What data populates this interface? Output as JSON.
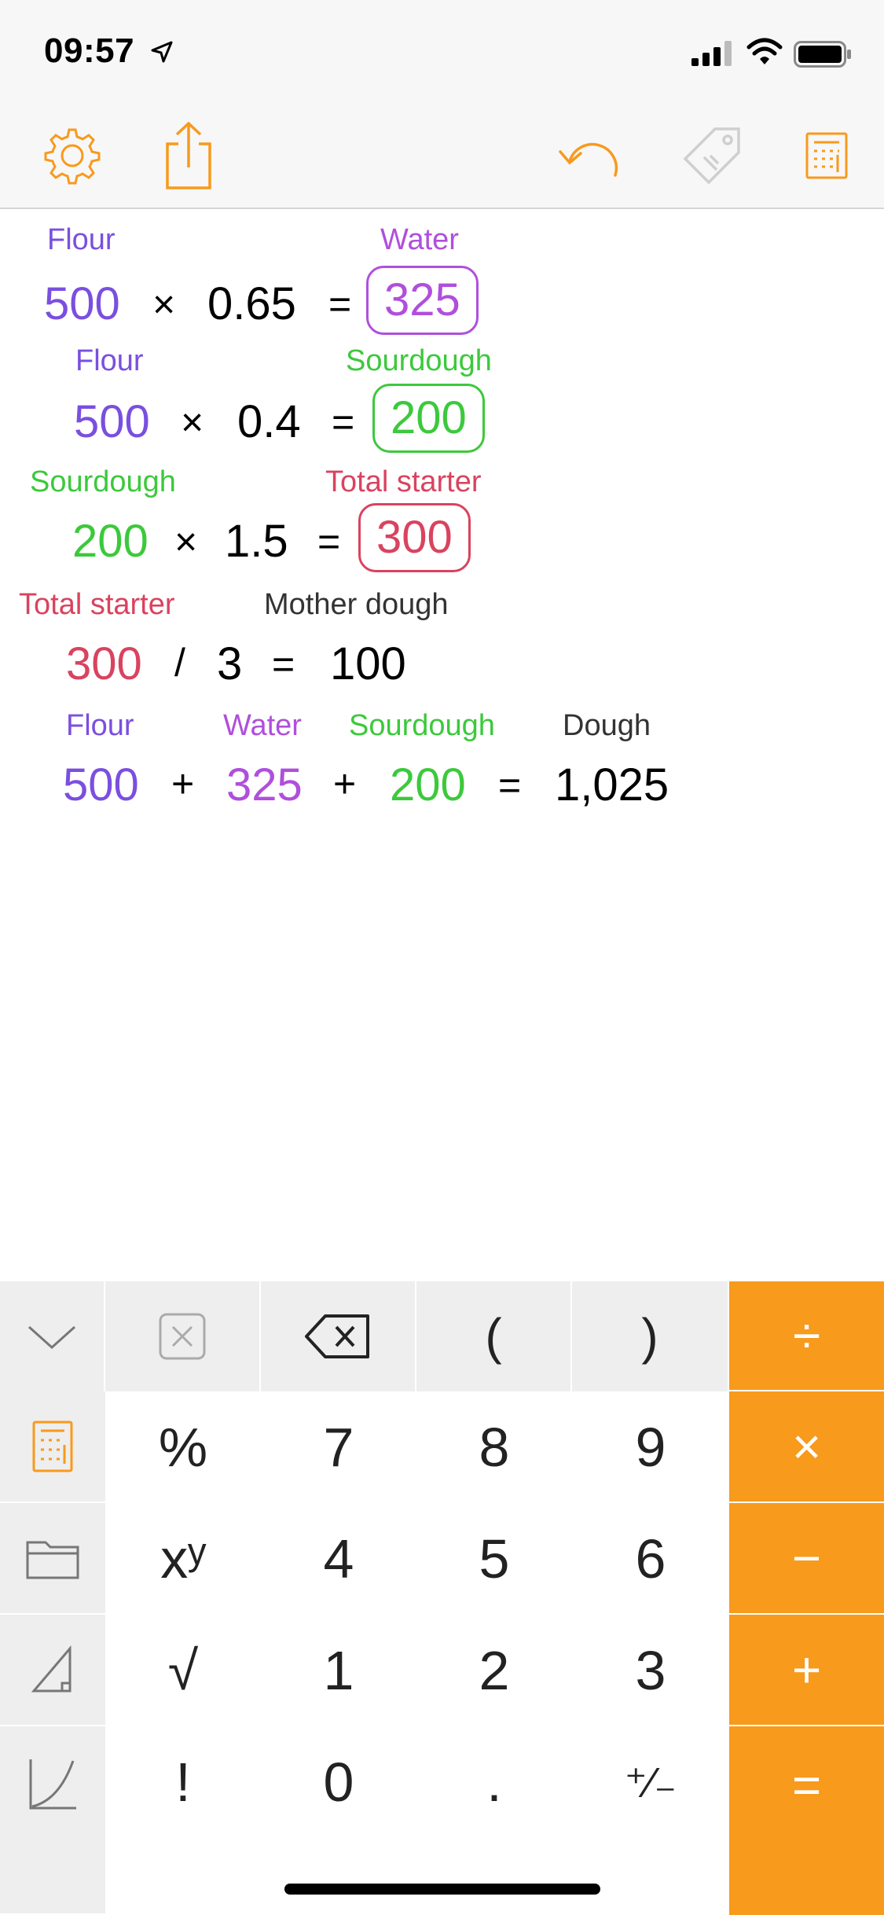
{
  "status": {
    "time": "09:57"
  },
  "toolbar": {
    "settings": "gear-icon",
    "share": "share-icon",
    "undo": "undo-icon",
    "tag": "tag-icon",
    "calculator": "calculator-icon"
  },
  "lines": [
    {
      "a_label": "Flour",
      "a": "500",
      "op": "×",
      "b": "0.65",
      "eq": "=",
      "r_label": "Water",
      "r": "325"
    },
    {
      "a_label": "Flour",
      "a": "500",
      "op": "×",
      "b": "0.4",
      "eq": "=",
      "r_label": "Sourdough",
      "r": "200"
    },
    {
      "a_label": "Sourdough",
      "a": "200",
      "op": "×",
      "b": "1.5",
      "eq": "=",
      "r_label": "Total starter",
      "r": "300"
    },
    {
      "a_label": "Total starter",
      "a": "300",
      "op": "/",
      "b": "3",
      "eq": "=",
      "r_label": "Mother dough",
      "r": "100"
    },
    {
      "a_label": "Flour",
      "a": "500",
      "op1": "+",
      "b_label": "Water",
      "b": "325",
      "op2": "+",
      "c_label": "Sourdough",
      "c": "200",
      "eq": "=",
      "r_label": "Dough",
      "r": "1,025"
    }
  ],
  "keypad": {
    "row0": {
      "collapse": "chevron-down-icon",
      "clear": "clear-icon",
      "backspace": "backspace-icon",
      "open_paren": "(",
      "close_paren": ")",
      "divide": "÷"
    },
    "side": {
      "calc": "calculator-icon",
      "folder": "folder-icon",
      "triangle": "triangle-icon",
      "graph": "graph-icon"
    },
    "rows": [
      [
        "%",
        "7",
        "8",
        "9"
      ],
      [
        "xʸ",
        "4",
        "5",
        "6"
      ],
      [
        "√",
        "1",
        "2",
        "3"
      ],
      [
        "!",
        "0",
        ".",
        "⁺⁄₋"
      ]
    ],
    "ops": [
      "×",
      "−",
      "+",
      "="
    ]
  },
  "colors": {
    "accent": "#f89a1c",
    "flour": "#7a4fdf",
    "water": "#b04fdc",
    "sourdough": "#3cc93c",
    "starter": "#d9435f"
  }
}
